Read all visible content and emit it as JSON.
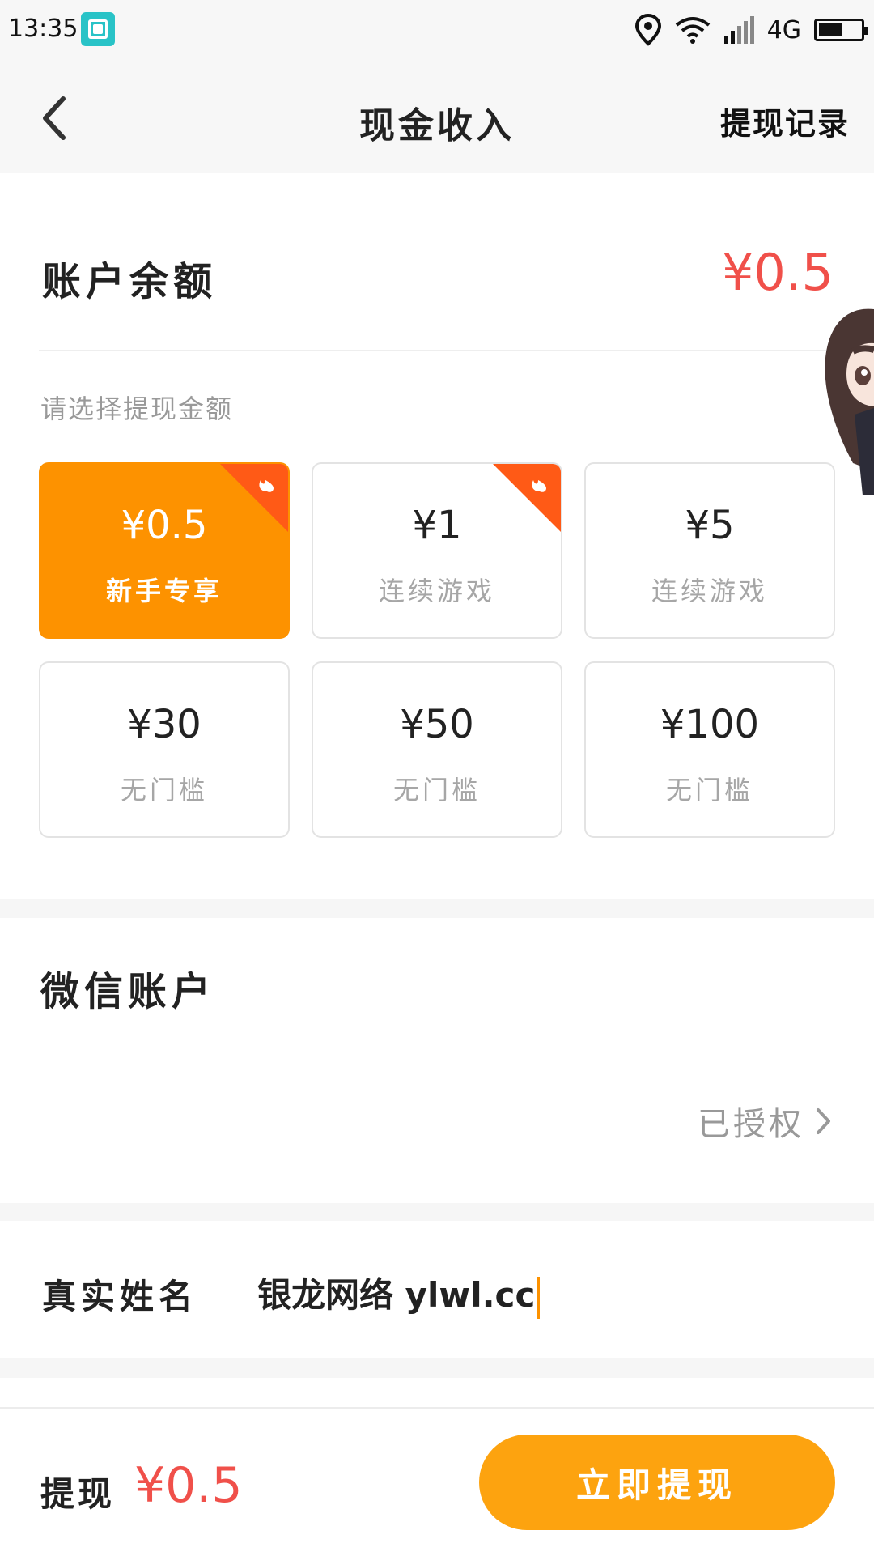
{
  "status_bar": {
    "time": "13:35",
    "network": "4G"
  },
  "header": {
    "title": "现金收入",
    "right_link": "提现记录"
  },
  "balance": {
    "label": "账户余额",
    "value": "¥0.5"
  },
  "amount_section": {
    "prompt": "请选择提现金额",
    "options": [
      {
        "value": "¥0.5",
        "subtitle": "新手专享",
        "selected": true,
        "hot": true
      },
      {
        "value": "¥1",
        "subtitle": "连续游戏",
        "selected": false,
        "hot": true
      },
      {
        "value": "¥5",
        "subtitle": "连续游戏",
        "selected": false,
        "hot": false
      },
      {
        "value": "¥30",
        "subtitle": "无门槛",
        "selected": false,
        "hot": false
      },
      {
        "value": "¥50",
        "subtitle": "无门槛",
        "selected": false,
        "hot": false
      },
      {
        "value": "¥100",
        "subtitle": "无门槛",
        "selected": false,
        "hot": false
      }
    ]
  },
  "wechat": {
    "title": "微信账户",
    "status": "已授权"
  },
  "real_name": {
    "label": "真实姓名",
    "value": "银龙网络 ylwl.cc"
  },
  "bottom": {
    "label": "提现",
    "amount": "¥0.5",
    "button": "立即提现"
  },
  "colors": {
    "accent": "#fd9200",
    "button": "#fda30f",
    "price": "#f0504a",
    "hot": "#ff5a16"
  },
  "icons": [
    "scan-icon",
    "location-icon",
    "wifi-icon",
    "signal-icon",
    "battery-icon",
    "back-arrow-icon",
    "fire-icon",
    "chevron-right-icon"
  ]
}
